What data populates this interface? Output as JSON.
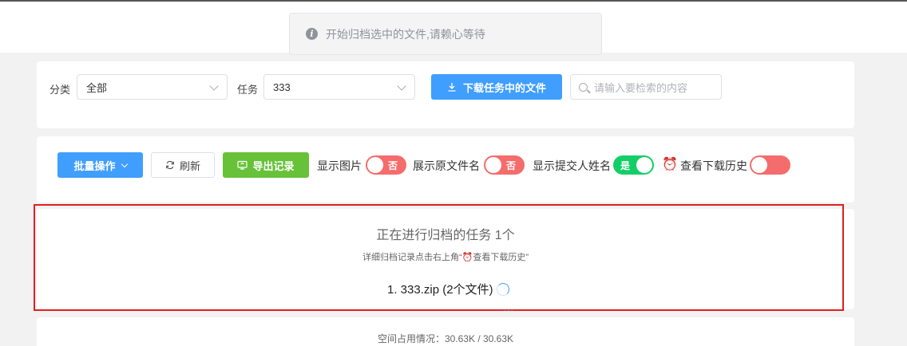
{
  "toast": {
    "icon": "info-icon",
    "message": "开始归档选中的文件,请赖心等待"
  },
  "filter": {
    "category_label": "分类",
    "category_value": "全部",
    "task_label": "任务",
    "task_value": "333",
    "download_button": "下载任务中的文件",
    "search_placeholder": "请输入要检索的内容"
  },
  "toolbar": {
    "batch_button": "批量操作",
    "refresh_button": "刷新",
    "export_button": "导出记录",
    "show_image_label": "显示图片",
    "show_image_state": "否",
    "show_original_name_label": "展示原文件名",
    "show_original_name_state": "否",
    "show_submitter_label": "显示提交人姓名",
    "show_submitter_state": "是",
    "history_icon": "alarm-clock-icon",
    "history_glyph": "⏰",
    "history_label": "查看下载历史"
  },
  "archive": {
    "title": "正在进行归档的任务 1个",
    "subtitle": "详细归档记录点击右上角“⏰查看下载历史”",
    "task": "1. 333.zip (2个文件)",
    "dots": "···"
  },
  "storage": {
    "usage": "空间占用情况：30.63K / 30.63K"
  },
  "colors": {
    "primary": "#409eff",
    "success": "#67c23a",
    "switch_off": "#f56c6c",
    "switch_on": "#13ce66",
    "highlight_border": "#e02020"
  }
}
